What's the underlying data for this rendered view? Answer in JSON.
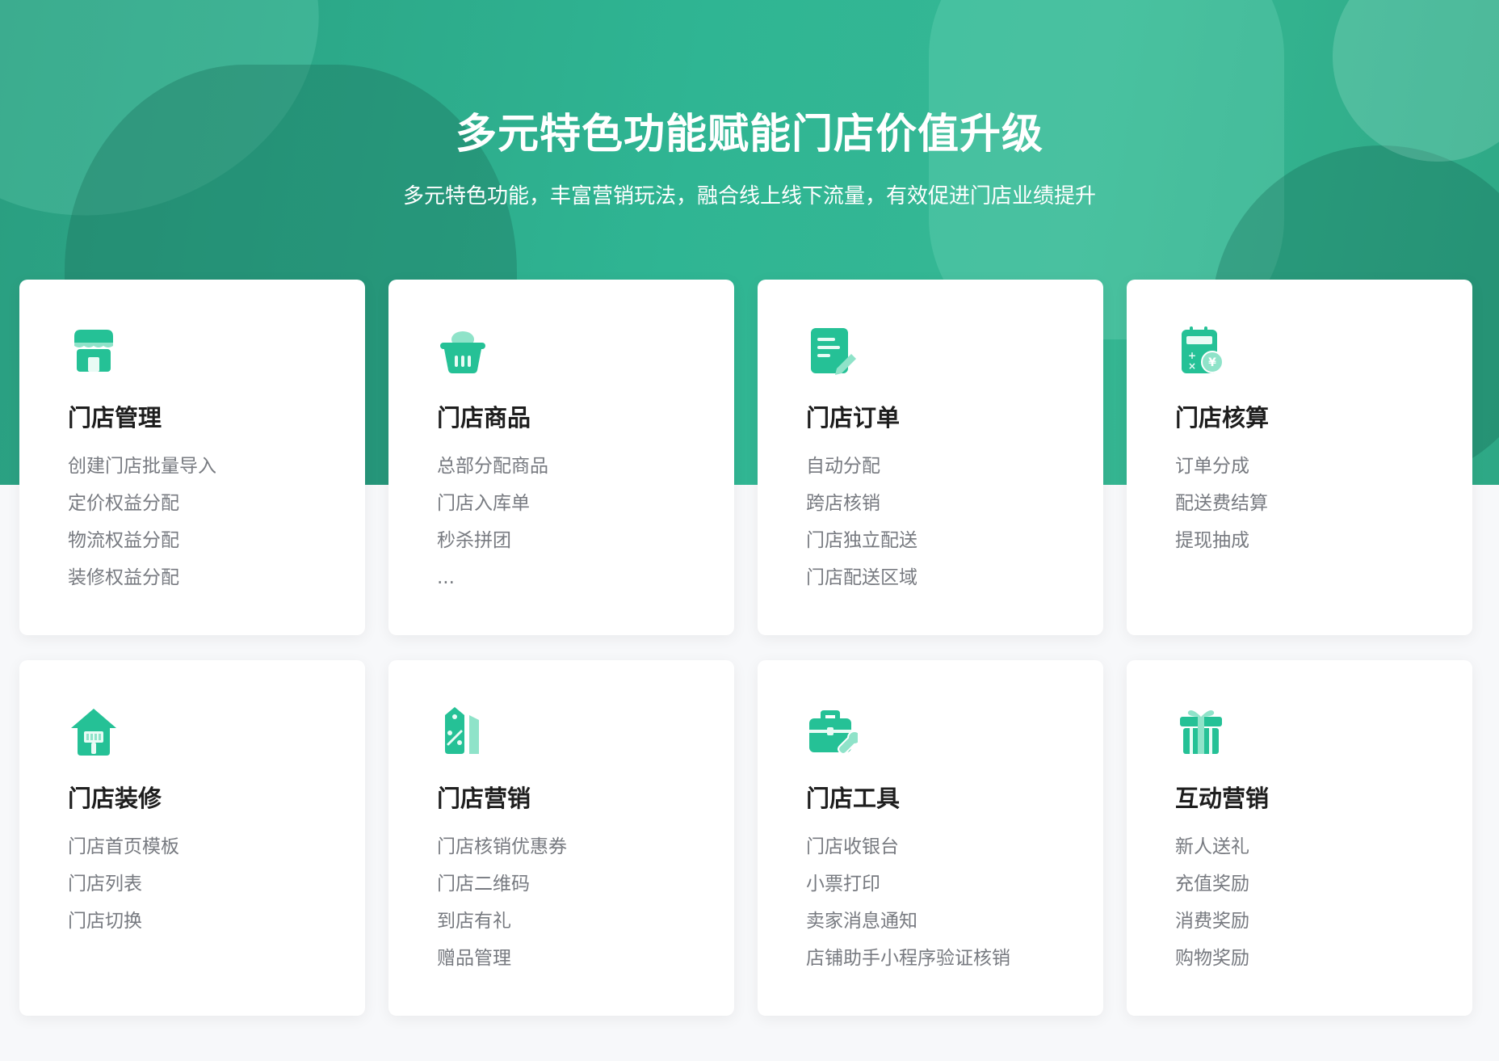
{
  "hero": {
    "title": "多元特色功能赋能门店价值升级",
    "subtitle": "多元特色功能，丰富营销玩法，融合线上线下流量，有效促进门店业绩提升"
  },
  "accent_color": "#25c196",
  "cards": [
    {
      "icon": "store-icon",
      "title": "门店管理",
      "items": [
        "创建门店批量导入",
        "定价权益分配",
        "物流权益分配",
        "装修权益分配"
      ]
    },
    {
      "icon": "basket-icon",
      "title": "门店商品",
      "items": [
        "总部分配商品",
        "门店入库单",
        "秒杀拼团",
        "..."
      ]
    },
    {
      "icon": "order-document-icon",
      "title": "门店订单",
      "items": [
        "自动分配",
        "跨店核销",
        "门店独立配送",
        "门店配送区域"
      ]
    },
    {
      "icon": "calculator-yen-icon",
      "title": "门店核算",
      "items": [
        "订单分成",
        "配送费结算",
        "提现抽成"
      ]
    },
    {
      "icon": "house-brush-icon",
      "title": "门店装修",
      "items": [
        "门店首页模板",
        "门店列表",
        "门店切换"
      ]
    },
    {
      "icon": "discount-tag-icon",
      "title": "门店营销",
      "items": [
        "门店核销优惠券",
        "门店二维码",
        "到店有礼",
        "赠品管理"
      ]
    },
    {
      "icon": "toolbox-wrench-icon",
      "title": "门店工具",
      "items": [
        "门店收银台",
        "小票打印",
        "卖家消息通知",
        "店铺助手小程序验证核销"
      ]
    },
    {
      "icon": "gift-icon",
      "title": "互动营销",
      "items": [
        "新人送礼",
        "充值奖励",
        "消费奖励",
        "购物奖励"
      ]
    }
  ]
}
